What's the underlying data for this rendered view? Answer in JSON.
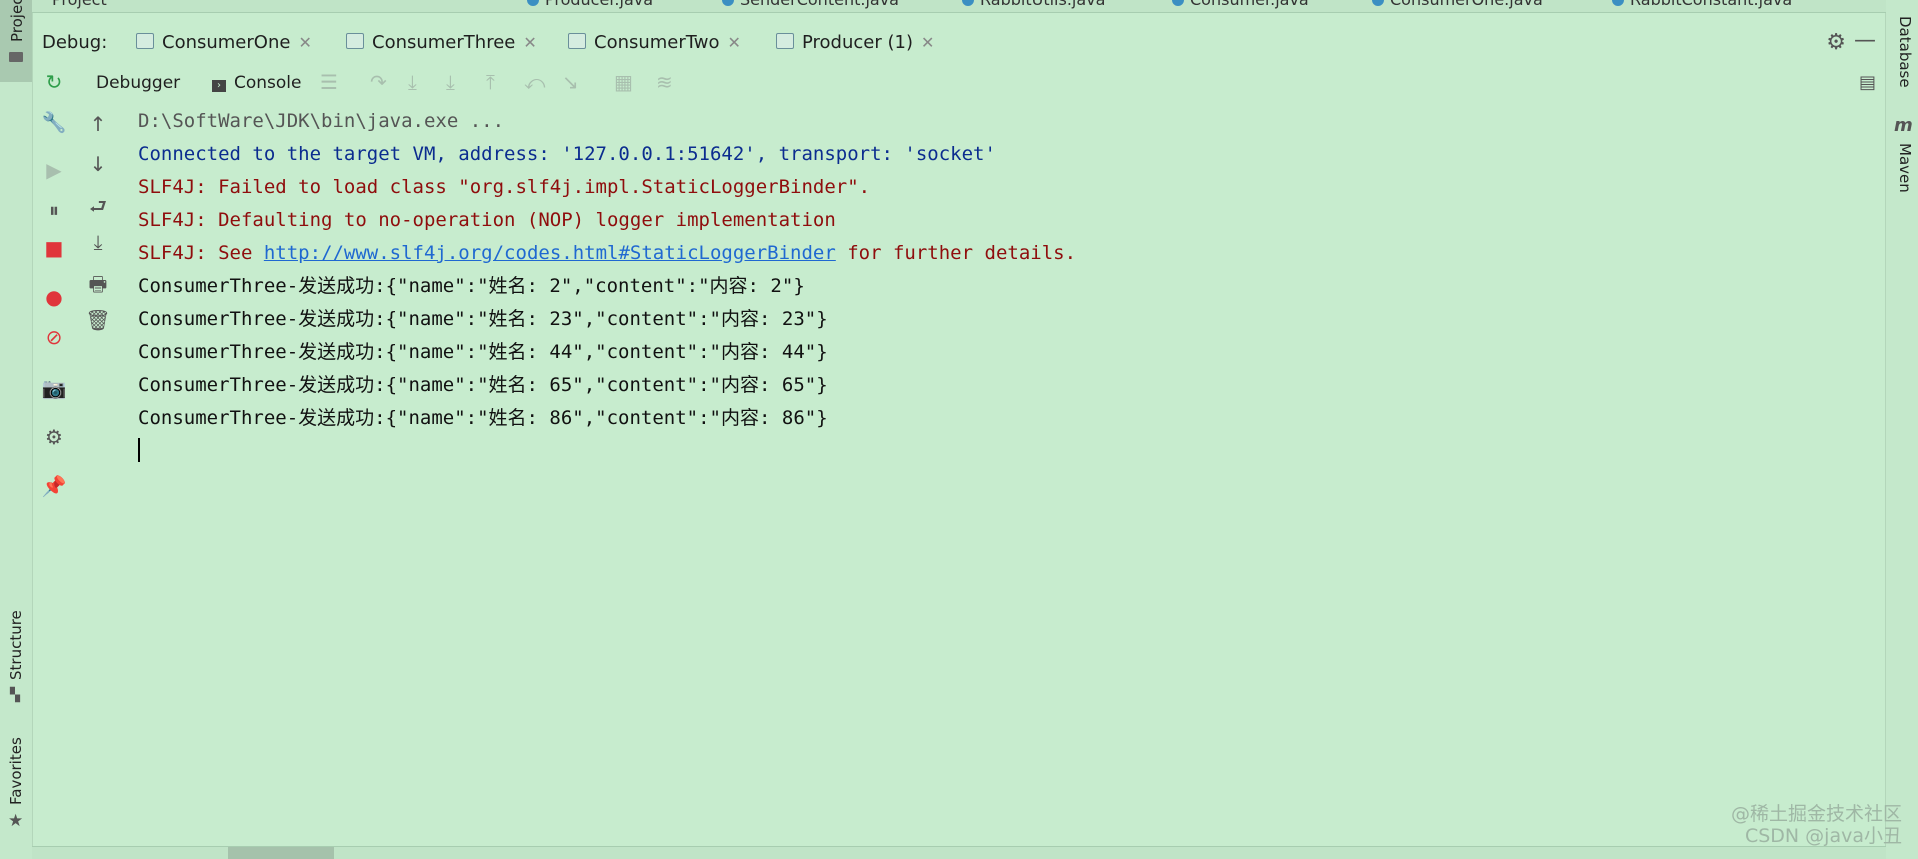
{
  "top_editor_tabs": [
    {
      "label": "Project"
    },
    {
      "label": "Producer.java"
    },
    {
      "label": "SenderContent.java"
    },
    {
      "label": "RabbitUtils.java"
    },
    {
      "label": "Consumer.java"
    },
    {
      "label": "ConsumerOne.java"
    },
    {
      "label": "RabbitConstant.java"
    }
  ],
  "left_stripe": {
    "project": "Project",
    "structure": "Structure",
    "favorites": "Favorites"
  },
  "right_stripe": {
    "database": "Database",
    "maven": "Maven"
  },
  "debug": {
    "label": "Debug:",
    "tabs": [
      {
        "label": "ConsumerOne"
      },
      {
        "label": "ConsumerThree"
      },
      {
        "label": "ConsumerTwo"
      },
      {
        "label": "Producer (1)"
      }
    ],
    "active_tab": "ConsumerThree"
  },
  "subtabs": {
    "debugger": "Debugger",
    "console": "Console"
  },
  "console": {
    "lines": [
      {
        "text": "D:\\SoftWare\\JDK\\bin\\java.exe ..."
      },
      {
        "text": "Connected to the target VM, address: '127.0.0.1:51642', transport: 'socket'"
      },
      {
        "text": "SLF4J: Failed to load class \"org.slf4j.impl.StaticLoggerBinder\"."
      },
      {
        "text": "SLF4J: Defaulting to no-operation (NOP) logger implementation"
      },
      {
        "prefix": "SLF4J: See ",
        "link": "http://www.slf4j.org/codes.html#StaticLoggerBinder",
        "suffix": " for further details."
      },
      {
        "text": "ConsumerThree-发送成功:{\"name\":\"姓名: 2\",\"content\":\"内容: 2\"}"
      },
      {
        "text": "ConsumerThree-发送成功:{\"name\":\"姓名: 23\",\"content\":\"内容: 23\"}"
      },
      {
        "text": "ConsumerThree-发送成功:{\"name\":\"姓名: 44\",\"content\":\"内容: 44\"}"
      },
      {
        "text": "ConsumerThree-发送成功:{\"name\":\"姓名: 65\",\"content\":\"内容: 65\"}"
      },
      {
        "text": "ConsumerThree-发送成功:{\"name\":\"姓名: 86\",\"content\":\"内容: 86\"}"
      }
    ]
  },
  "watermark": {
    "line1": "@稀土掘金技术社区",
    "line2": "CSDN @java小丑"
  },
  "colors": {
    "background": "#c7ecce",
    "console_blue": "#0b2c8f",
    "console_red": "#8f0d0d",
    "link": "#1f68d1",
    "stop_red": "#e0353b",
    "rerun_green": "#2e9e4a"
  }
}
